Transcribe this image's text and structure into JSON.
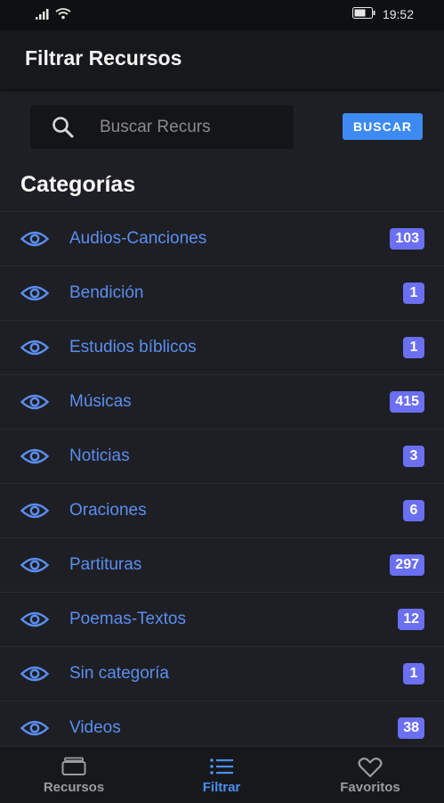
{
  "status_bar": {
    "time": "19:52"
  },
  "app_bar": {
    "title": "Filtrar Recursos"
  },
  "search": {
    "placeholder": "Buscar Recurs",
    "button_label": "BUSCAR"
  },
  "categories_title": "Categorías",
  "categories": [
    {
      "label": "Audios-Canciones",
      "count": "103"
    },
    {
      "label": "Bendición",
      "count": "1"
    },
    {
      "label": "Estudios bíblicos",
      "count": "1"
    },
    {
      "label": "Músicas",
      "count": "415"
    },
    {
      "label": "Noticias",
      "count": "3"
    },
    {
      "label": "Oraciones",
      "count": "6"
    },
    {
      "label": "Partituras",
      "count": "297"
    },
    {
      "label": "Poemas-Textos",
      "count": "12"
    },
    {
      "label": "Sin categoría",
      "count": "1"
    },
    {
      "label": "Videos",
      "count": "38"
    }
  ],
  "bottom_nav": [
    {
      "label": "Recursos",
      "icon": "resources-icon",
      "active": false
    },
    {
      "label": "Filtrar",
      "icon": "list-icon",
      "active": true
    },
    {
      "label": "Favoritos",
      "icon": "heart-icon",
      "active": false
    }
  ],
  "colors": {
    "accent": "#3d8bf2",
    "link": "#5b8ef0",
    "badge": "#6b6ff2",
    "background": "#1e1f24"
  }
}
